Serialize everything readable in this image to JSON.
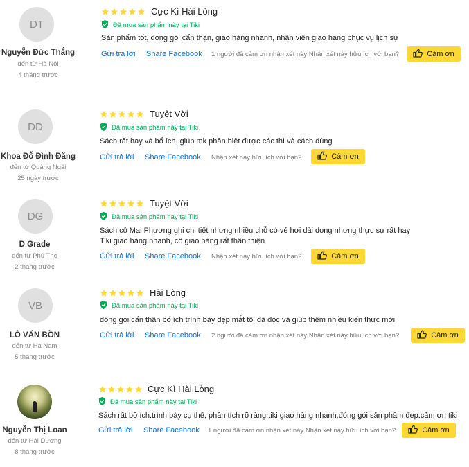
{
  "colors": {
    "star": "#fdd835",
    "verified": "#00ab56",
    "link": "#0b74e5",
    "button": "#fdd835"
  },
  "reviews": [
    {
      "initials": "DT",
      "name": "Nguyễn Đức Thắng",
      "from": "đến từ Hà Nội",
      "ago": "4 tháng trước",
      "rating": 5,
      "title": "Cực Kì Hài Lòng",
      "verified": "Đã mua sản phẩm này tại Tiki",
      "content": [
        "Sản phẩm tốt, đóng gói cẩn thận, giao hàng nhanh, nhân viên giao hàng phục vụ lịch sự"
      ],
      "reply": "Gửi trả lời",
      "share": "Share Facebook",
      "helpful": "1 người đã cảm ơn nhận xét này Nhận xét này hữu ích với bạn?",
      "thanks": "Cảm ơn"
    },
    {
      "initials": "DD",
      "name": "Khoa Đỗ Đình Đăng",
      "from": "đến từ Quảng Ngãi",
      "ago": "25 ngày trước",
      "rating": 5,
      "title": "Tuyệt Vời",
      "verified": "Đã mua sản phẩm này tại Tiki",
      "content": [
        "Sách rất hay và bổ ích, giúp mk phân biệt được các thì và cách dùng"
      ],
      "reply": "Gửi trả lời",
      "share": "Share Facebook",
      "helpful": "Nhận xét này hữu ích với bạn?",
      "thanks": "Cảm ơn"
    },
    {
      "initials": "DG",
      "name": "D Grade",
      "from": "đến từ Phú Thọ",
      "ago": "2 tháng trước",
      "rating": 5,
      "title": "Tuyệt Vời",
      "verified": "Đã mua sản phẩm này tại Tiki",
      "content": [
        "Sách cô Mai Phương ghi chi tiết nhưng nhiều chỗ có vẻ hơi dài dong nhưng thực sự rất hay",
        "Tiki giao hàng nhanh, cô giao hàng rất thân thiện"
      ],
      "reply": "Gửi trả lời",
      "share": "Share Facebook",
      "helpful": "Nhận xét này hữu ích với bạn?",
      "thanks": "Cảm ơn"
    },
    {
      "initials": "VB",
      "name": "LÒ VĂN BỒN",
      "from": "đến từ Hà Nam",
      "ago": "5 tháng trước",
      "rating": 5,
      "title": "Hài Lòng",
      "verified": "Đã mua sản phẩm này tại Tiki",
      "content": [
        "đóng gói cẩn thận bổ ích trình bày đẹp mắt tôi đã đọc và giúp thêm nhiều kiến thức mới"
      ],
      "reply": "Gửi trả lời",
      "share": "Share Facebook",
      "helpful": "2 người đã cảm ơn nhận xét này Nhận xét này hữu ích với bạn?",
      "thanks": "Cảm ơn"
    },
    {
      "initials": "",
      "name": "Nguyễn Thị Loan",
      "from": "đến từ Hải Dương",
      "ago": "8 tháng trước",
      "rating": 5,
      "title": "Cực Kì Hài Lòng",
      "verified": "Đã mua sản phẩm này tại Tiki",
      "content": [
        "Sách rất bổ ích.trình bày cụ thể, phân tích rõ ràng.tiki giao hàng nhanh,đóng gói sản phẩm đẹp.cảm ơn tiki"
      ],
      "reply": "Gửi trả lời",
      "share": "Share Facebook",
      "helpful": "1 người đã cảm ơn nhận xét này Nhận xét này hữu ích với bạn?",
      "thanks": "Cảm ơn"
    }
  ]
}
